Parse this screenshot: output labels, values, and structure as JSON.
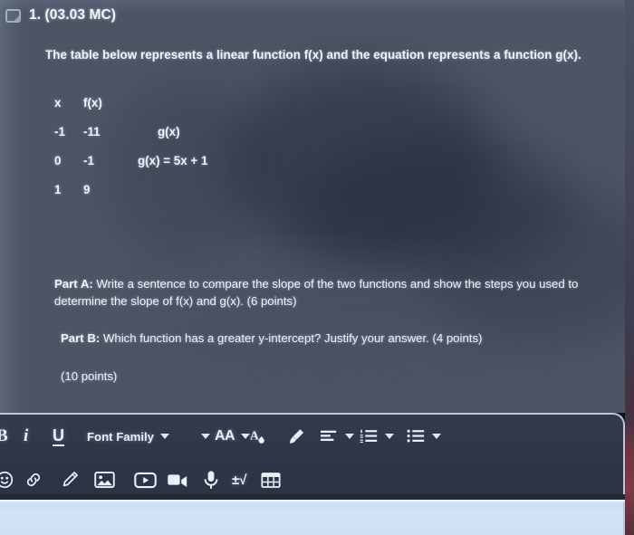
{
  "question": {
    "flag_icon": "flag-icon",
    "number_label": "1. (03.03 MC)",
    "prompt": "The table below represents a linear function f(x) and the equation represents a function g(x).",
    "table": {
      "headers": [
        "x",
        "f(x)"
      ],
      "rows": [
        [
          "-1",
          "-11"
        ],
        [
          "0",
          "-1"
        ],
        [
          "1",
          "9"
        ]
      ]
    },
    "g_label": "g(x)",
    "g_equation": "g(x) = 5x + 1",
    "part_a_label": "Part A:",
    "part_a_text": "Write a sentence to compare the slope of the two functions and show the steps you used to determine the slope of f(x) and g(x). (6 points)",
    "part_b_label": "Part B:",
    "part_b_text": "Which function has a greater y-intercept? Justify your answer. (4 points)",
    "total_points": "(10 points)"
  },
  "toolbar": {
    "row1": [
      {
        "name": "bold-button",
        "label": "B",
        "kind": "text-bold",
        "caret": false
      },
      {
        "name": "italic-button",
        "label": "i",
        "kind": "text-italic",
        "caret": false
      },
      {
        "name": "underline-button",
        "label": "U",
        "kind": "text-under",
        "caret": false
      },
      {
        "name": "font-family-dropdown",
        "label": "Font Family",
        "kind": "text-plain",
        "caret": true
      },
      {
        "name": "font-size-dropdown",
        "label": "AA",
        "kind": "text-aa",
        "caret": true
      },
      {
        "name": "text-color-button",
        "label": "",
        "kind": "icon-textcolor",
        "caret": false
      },
      {
        "name": "highlighter-button",
        "label": "",
        "kind": "icon-highlight",
        "caret": false
      },
      {
        "name": "align-dropdown",
        "label": "",
        "kind": "icon-align",
        "caret": true
      },
      {
        "name": "numbered-list-dropdown",
        "label": "",
        "kind": "icon-numlist",
        "caret": true
      },
      {
        "name": "bulleted-list-dropdown",
        "label": "",
        "kind": "icon-bullist",
        "caret": true
      }
    ],
    "row2": [
      {
        "name": "emoji-button",
        "label": "",
        "kind": "icon-emoji"
      },
      {
        "name": "link-button",
        "label": "",
        "kind": "icon-link"
      },
      {
        "name": "draw-button",
        "label": "",
        "kind": "icon-pencil"
      },
      {
        "name": "insert-image-button",
        "label": "",
        "kind": "icon-image"
      },
      {
        "name": "insert-video-button",
        "label": "",
        "kind": "icon-video"
      },
      {
        "name": "record-video-button",
        "label": "",
        "kind": "icon-camcorder"
      },
      {
        "name": "record-audio-button",
        "label": "",
        "kind": "icon-microphone"
      },
      {
        "name": "math-equation-button",
        "label": "±√",
        "kind": "text-math"
      },
      {
        "name": "insert-table-button",
        "label": "",
        "kind": "icon-table"
      }
    ]
  },
  "colors": {
    "page_background": "#4d5565",
    "toolbar_background": "#2e3647",
    "editor_surface": "#cfdff4",
    "text": "#eef4fb",
    "border": "#b9c7db"
  }
}
